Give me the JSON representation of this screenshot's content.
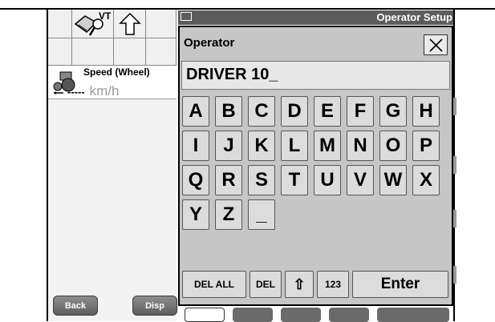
{
  "left_panel": {
    "vt_label": "VT",
    "speed": {
      "label": "Speed (Wheel)",
      "value": "-----",
      "unit": "km/h"
    },
    "back_button": "Back",
    "disp_button": "Disp"
  },
  "header": {
    "title": "Operator Setup"
  },
  "dialog": {
    "title": "Operator",
    "close_label": "X",
    "entry_value": "DRIVER 10_",
    "keys_row1": [
      "A",
      "B",
      "C",
      "D",
      "E",
      "F",
      "G",
      "H"
    ],
    "keys_row2": [
      "I",
      "J",
      "K",
      "L",
      "M",
      "N",
      "O",
      "P"
    ],
    "keys_row3": [
      "Q",
      "R",
      "S",
      "T",
      "U",
      "V",
      "W",
      "X"
    ],
    "keys_row4": [
      "Y",
      "Z",
      "_"
    ],
    "bottom": {
      "del_all": "DEL ALL",
      "del": "DEL",
      "shift": "⇧",
      "numeric": "123",
      "enter": "Enter"
    }
  },
  "colors": {
    "dialog_bg": "#c6c6c6",
    "key_bg": "#dcdcdc",
    "header_bg": "#5c5c5c"
  }
}
